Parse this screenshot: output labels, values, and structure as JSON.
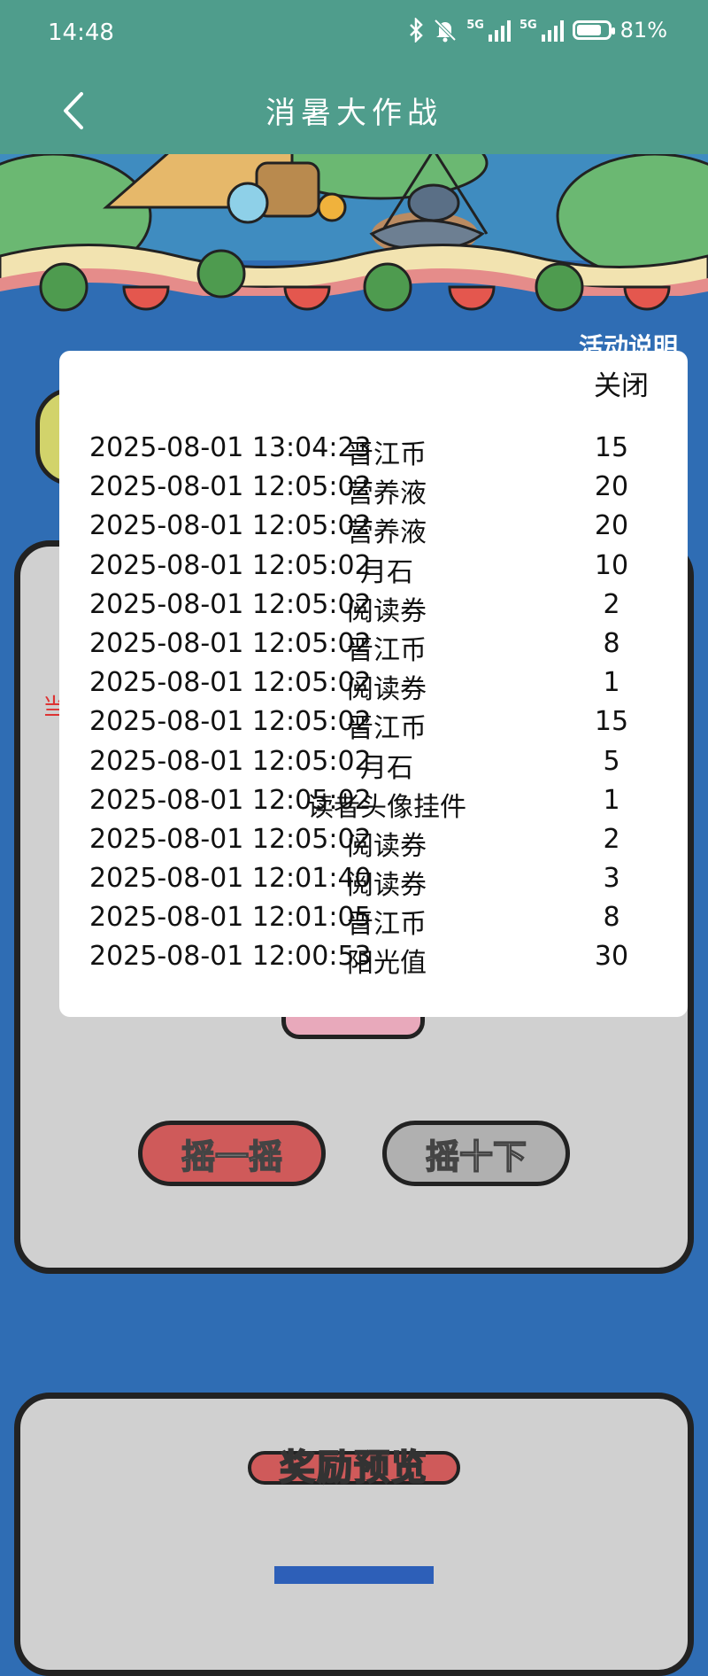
{
  "status_bar": {
    "time": "14:48",
    "network_1": "5G",
    "network_2": "5G",
    "battery_text": "81%",
    "battery_level": 0.81
  },
  "nav": {
    "title": "消暑大作战"
  },
  "page": {
    "rules_label": "活动说明",
    "hint_char": "当",
    "shake_once_label": "摇一摇",
    "shake_ten_label": "摇十下",
    "reward_preview_label": "奖励预览"
  },
  "record_dialog": {
    "close_label": "关闭",
    "records": [
      {
        "time": "2025-08-01 13:04:23",
        "item": "晋江币",
        "qty": "15"
      },
      {
        "time": "2025-08-01 12:05:02",
        "item": "营养液",
        "qty": "20"
      },
      {
        "time": "2025-08-01 12:05:02",
        "item": "营养液",
        "qty": "20"
      },
      {
        "time": "2025-08-01 12:05:02",
        "item": "月石",
        "qty": "10"
      },
      {
        "time": "2025-08-01 12:05:02",
        "item": "阅读券",
        "qty": "2"
      },
      {
        "time": "2025-08-01 12:05:02",
        "item": "晋江币",
        "qty": "8"
      },
      {
        "time": "2025-08-01 12:05:02",
        "item": "阅读券",
        "qty": "1"
      },
      {
        "time": "2025-08-01 12:05:02",
        "item": "晋江币",
        "qty": "15"
      },
      {
        "time": "2025-08-01 12:05:02",
        "item": "月石",
        "qty": "5"
      },
      {
        "time": "2025-08-01 12:05:02",
        "item": "读者头像挂件",
        "qty": "1"
      },
      {
        "time": "2025-08-01 12:05:02",
        "item": "阅读券",
        "qty": "2"
      },
      {
        "time": "2025-08-01 12:01:40",
        "item": "阅读券",
        "qty": "3"
      },
      {
        "time": "2025-08-01 12:01:05",
        "item": "晋江币",
        "qty": "8"
      },
      {
        "time": "2025-08-01 12:00:53",
        "item": "阳光值",
        "qty": "30"
      }
    ]
  },
  "colors": {
    "header": "#4f9d8c",
    "page_background": "#2f6db4",
    "card": "#d0d0d0",
    "accent_red": "#cf5a5a",
    "hint_red": "#dd3333"
  }
}
